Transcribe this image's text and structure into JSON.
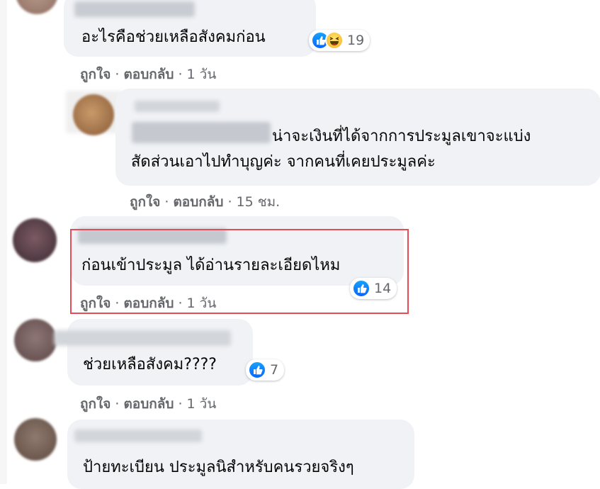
{
  "comments": [
    {
      "text_lines": [
        "อะไรคือช่วยเหลือสังคมก่อน"
      ],
      "reactions": [
        "like-icon",
        "haha-icon"
      ],
      "reaction_count": "19",
      "actions": {
        "like": "ถูกใจ",
        "reply": "ตอบกลับ",
        "time": "1 วัน"
      }
    },
    {
      "text_lines": [
        "น่าจะเงินที่ได้จากการประมูลเขาจะแบ่ง",
        "สัดส่วนเอาไปทำบุญค่ะ จากคนที่เคยประมูลค่ะ"
      ],
      "actions": {
        "like": "ถูกใจ",
        "reply": "ตอบกลับ",
        "time": "15 ชม."
      }
    },
    {
      "text_lines": [
        "ก่อนเข้าประมูล ได้อ่านรายละเอียดไหม"
      ],
      "reactions": [
        "like-icon"
      ],
      "reaction_count": "14",
      "actions": {
        "like": "ถูกใจ",
        "reply": "ตอบกลับ",
        "time": "1 วัน"
      }
    },
    {
      "text_lines": [
        "ช่วยเหลือสังคม????"
      ],
      "reactions": [
        "like-icon"
      ],
      "reaction_count": "7",
      "actions": {
        "like": "ถูกใจ",
        "reply": "ตอบกลับ",
        "time": "1 วัน"
      }
    },
    {
      "text_lines": [
        "ป้ายทะเบียน ประมูลนิสำหรับคนรวยจริงๆ"
      ]
    }
  ],
  "separator": "·",
  "colors": {
    "highlight_border": "#e84b55",
    "like_blue": "#0866ff",
    "bubble": "#f0f2f5"
  }
}
